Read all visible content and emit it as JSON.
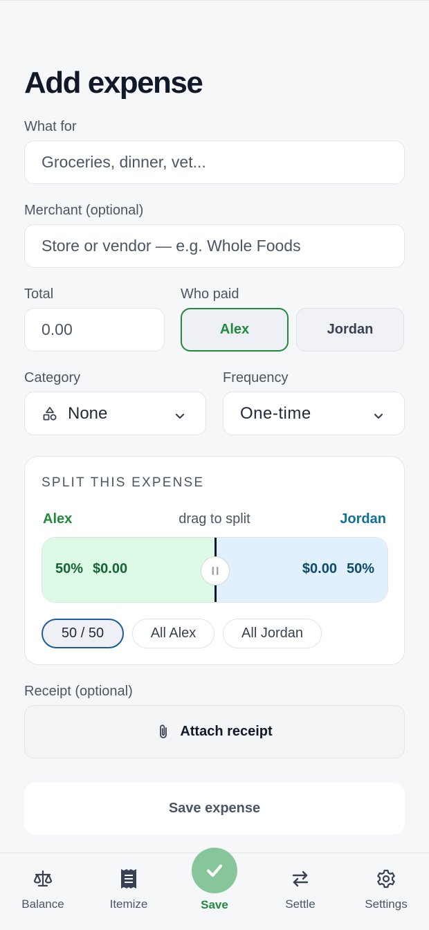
{
  "page": {
    "title": "Add expense"
  },
  "form": {
    "what_for": {
      "label": "What for",
      "placeholder": "Groceries, dinner, vet..."
    },
    "merchant": {
      "label": "Merchant (optional)",
      "placeholder": "Store or vendor — e.g. Whole Foods"
    },
    "total": {
      "label": "Total",
      "placeholder": "0.00"
    },
    "who_paid": {
      "label": "Who paid",
      "options": [
        "Alex",
        "Jordan"
      ],
      "selected": "Alex"
    },
    "category": {
      "label": "Category",
      "value": "None",
      "icon": "shapes-icon"
    },
    "frequency": {
      "label": "Frequency",
      "value": "One-time"
    }
  },
  "split": {
    "title": "SPLIT THIS EXPENSE",
    "left_name": "Alex",
    "right_name": "Jordan",
    "hint": "drag to split",
    "left_pct": "50%",
    "left_amount": "$0.00",
    "right_amount": "$0.00",
    "right_pct": "50%",
    "presets": [
      "50 / 50",
      "All Alex",
      "All Jordan"
    ],
    "selected_preset": "50 / 50"
  },
  "receipt": {
    "label": "Receipt (optional)",
    "button": "Attach receipt",
    "icon": "paperclip-icon"
  },
  "actions": {
    "save": "Save expense"
  },
  "nav": {
    "items": [
      {
        "label": "Balance",
        "icon": "scale-icon"
      },
      {
        "label": "Itemize",
        "icon": "receipt-icon"
      },
      {
        "label": "Save",
        "icon": "check-icon"
      },
      {
        "label": "Settle",
        "icon": "arrows-swap-icon"
      },
      {
        "label": "Settings",
        "icon": "gear-icon"
      }
    ],
    "active": "Save"
  },
  "colors": {
    "alex_green": "#1f8a3b",
    "jordan_blue": "#0e6e9c",
    "fab_green": "#86c69a"
  }
}
